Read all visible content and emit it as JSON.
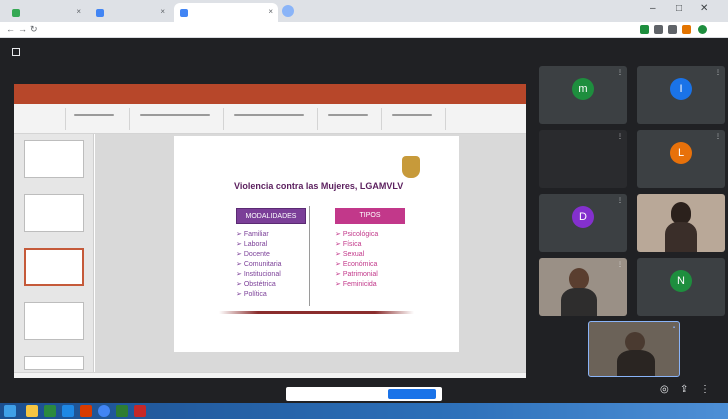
{
  "browser": {
    "tabs": [
      {
        "label": "",
        "color": "#34a853"
      },
      {
        "label": "",
        "color": "#4285f4"
      },
      {
        "label": "",
        "color": "#4285f4"
      }
    ],
    "url": ""
  },
  "meet": {
    "presenting_label": "",
    "tile_toggle": "",
    "meeting_id": "",
    "presentation_banner": "",
    "stop_label": ""
  },
  "powerpoint": {
    "title_bar": "",
    "tabs": ""
  },
  "slide": {
    "title": "Violencia contra las Mujeres, LGAMVLV",
    "modalidades_header": "MODALIDADES",
    "tipos_header": "TIPOS",
    "modalidades": [
      "Familiar",
      "Laboral",
      "Docente",
      "Comunitaria",
      "Institucional",
      "Obstétrica",
      "Política"
    ],
    "tipos": [
      "Psicológica",
      "Física",
      "Sexual",
      "Económica",
      "Patrimonial",
      "Feminicida"
    ]
  },
  "participants": [
    {
      "initial": "m",
      "color": "#1e8e3e",
      "name": ""
    },
    {
      "initial": "I",
      "color": "#1a73e8",
      "name": ""
    },
    {
      "initial": "",
      "color": "",
      "name": ""
    },
    {
      "initial": "L",
      "color": "#e8710a",
      "name": ""
    },
    {
      "initial": "D",
      "color": "#8430ce",
      "name": ""
    },
    {
      "initial": "",
      "color": "",
      "name": ""
    },
    {
      "initial": "",
      "color": "",
      "name": ""
    },
    {
      "initial": "N",
      "color": "#1e8e3e",
      "name": ""
    }
  ],
  "taskbar": {
    "clock": ""
  }
}
